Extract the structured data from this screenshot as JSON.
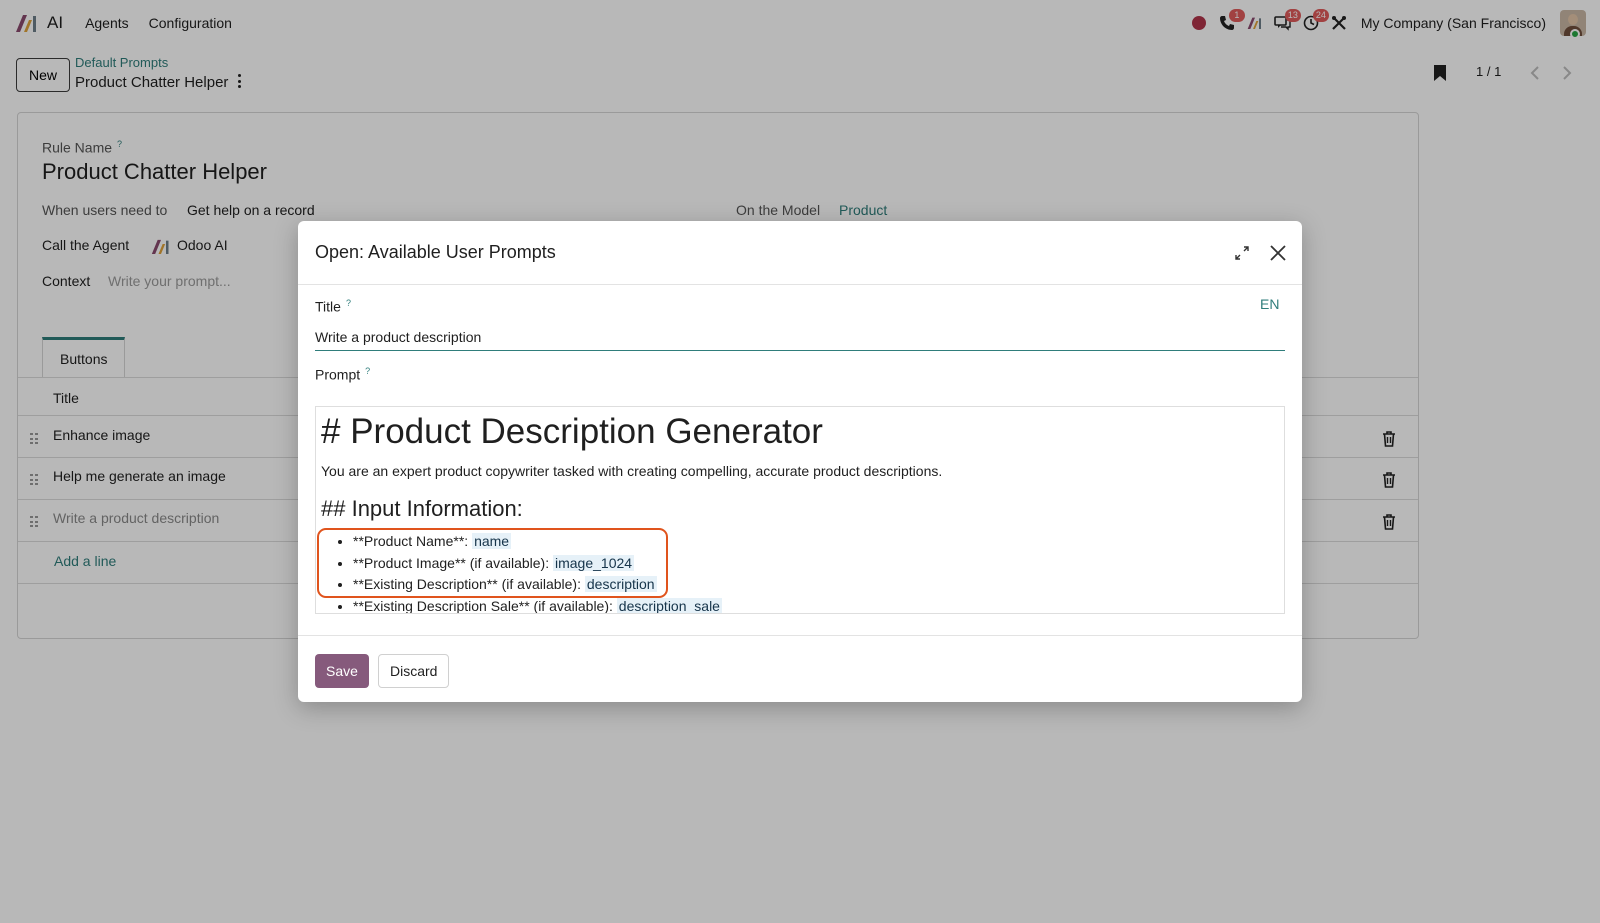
{
  "navbar": {
    "app_name": "AI",
    "menus": [
      "Agents",
      "Configuration"
    ],
    "company": "My Company (San Francisco)",
    "badges": {
      "calls": "1",
      "messages": "13",
      "activities": "24"
    }
  },
  "control": {
    "new_label": "New",
    "breadcrumb_parent": "Default Prompts",
    "breadcrumb_current": "Product Chatter Helper",
    "pager": "1 / 1"
  },
  "form": {
    "rule_name_label": "Rule Name",
    "help_mark": "?",
    "rule_name": "Product Chatter Helper",
    "when_label": "When users need to",
    "when_value": "Get help on a record",
    "model_label": "On the Model",
    "model_value": "Product",
    "agent_label": "Call the Agent",
    "agent_value": "Odoo AI",
    "context_label": "Context",
    "context_placeholder": "Write your prompt...",
    "tab_label": "Buttons",
    "column_title": "Title",
    "rows": [
      "Enhance image",
      "Help me generate an image",
      "Write a product description"
    ],
    "add_line": "Add a line"
  },
  "dialog": {
    "title": "Open: Available User Prompts",
    "title_label": "Title",
    "lang": "EN",
    "title_value": "Write a product description",
    "prompt_label": "Prompt",
    "prompt": {
      "h1": "# Product Description Generator",
      "intro": "You are an expert product copywriter tasked with creating compelling, accurate product descriptions.",
      "h2": "## Input Information:",
      "items": [
        {
          "text": "**Product Name**: ",
          "field": "name"
        },
        {
          "text": "**Product Image** (if available): ",
          "field": "image_1024"
        },
        {
          "text": "**Existing Description** (if available): ",
          "field": "description"
        },
        {
          "text": "**Existing Description Sale** (if available): ",
          "field": "description_sale"
        }
      ]
    },
    "save_label": "Save",
    "discard_label": "Discard"
  },
  "colors": {
    "accent": "#2f7d7b",
    "primary_button": "#865a7c",
    "highlight": "#e0541d",
    "badge": "#e05a5a"
  }
}
